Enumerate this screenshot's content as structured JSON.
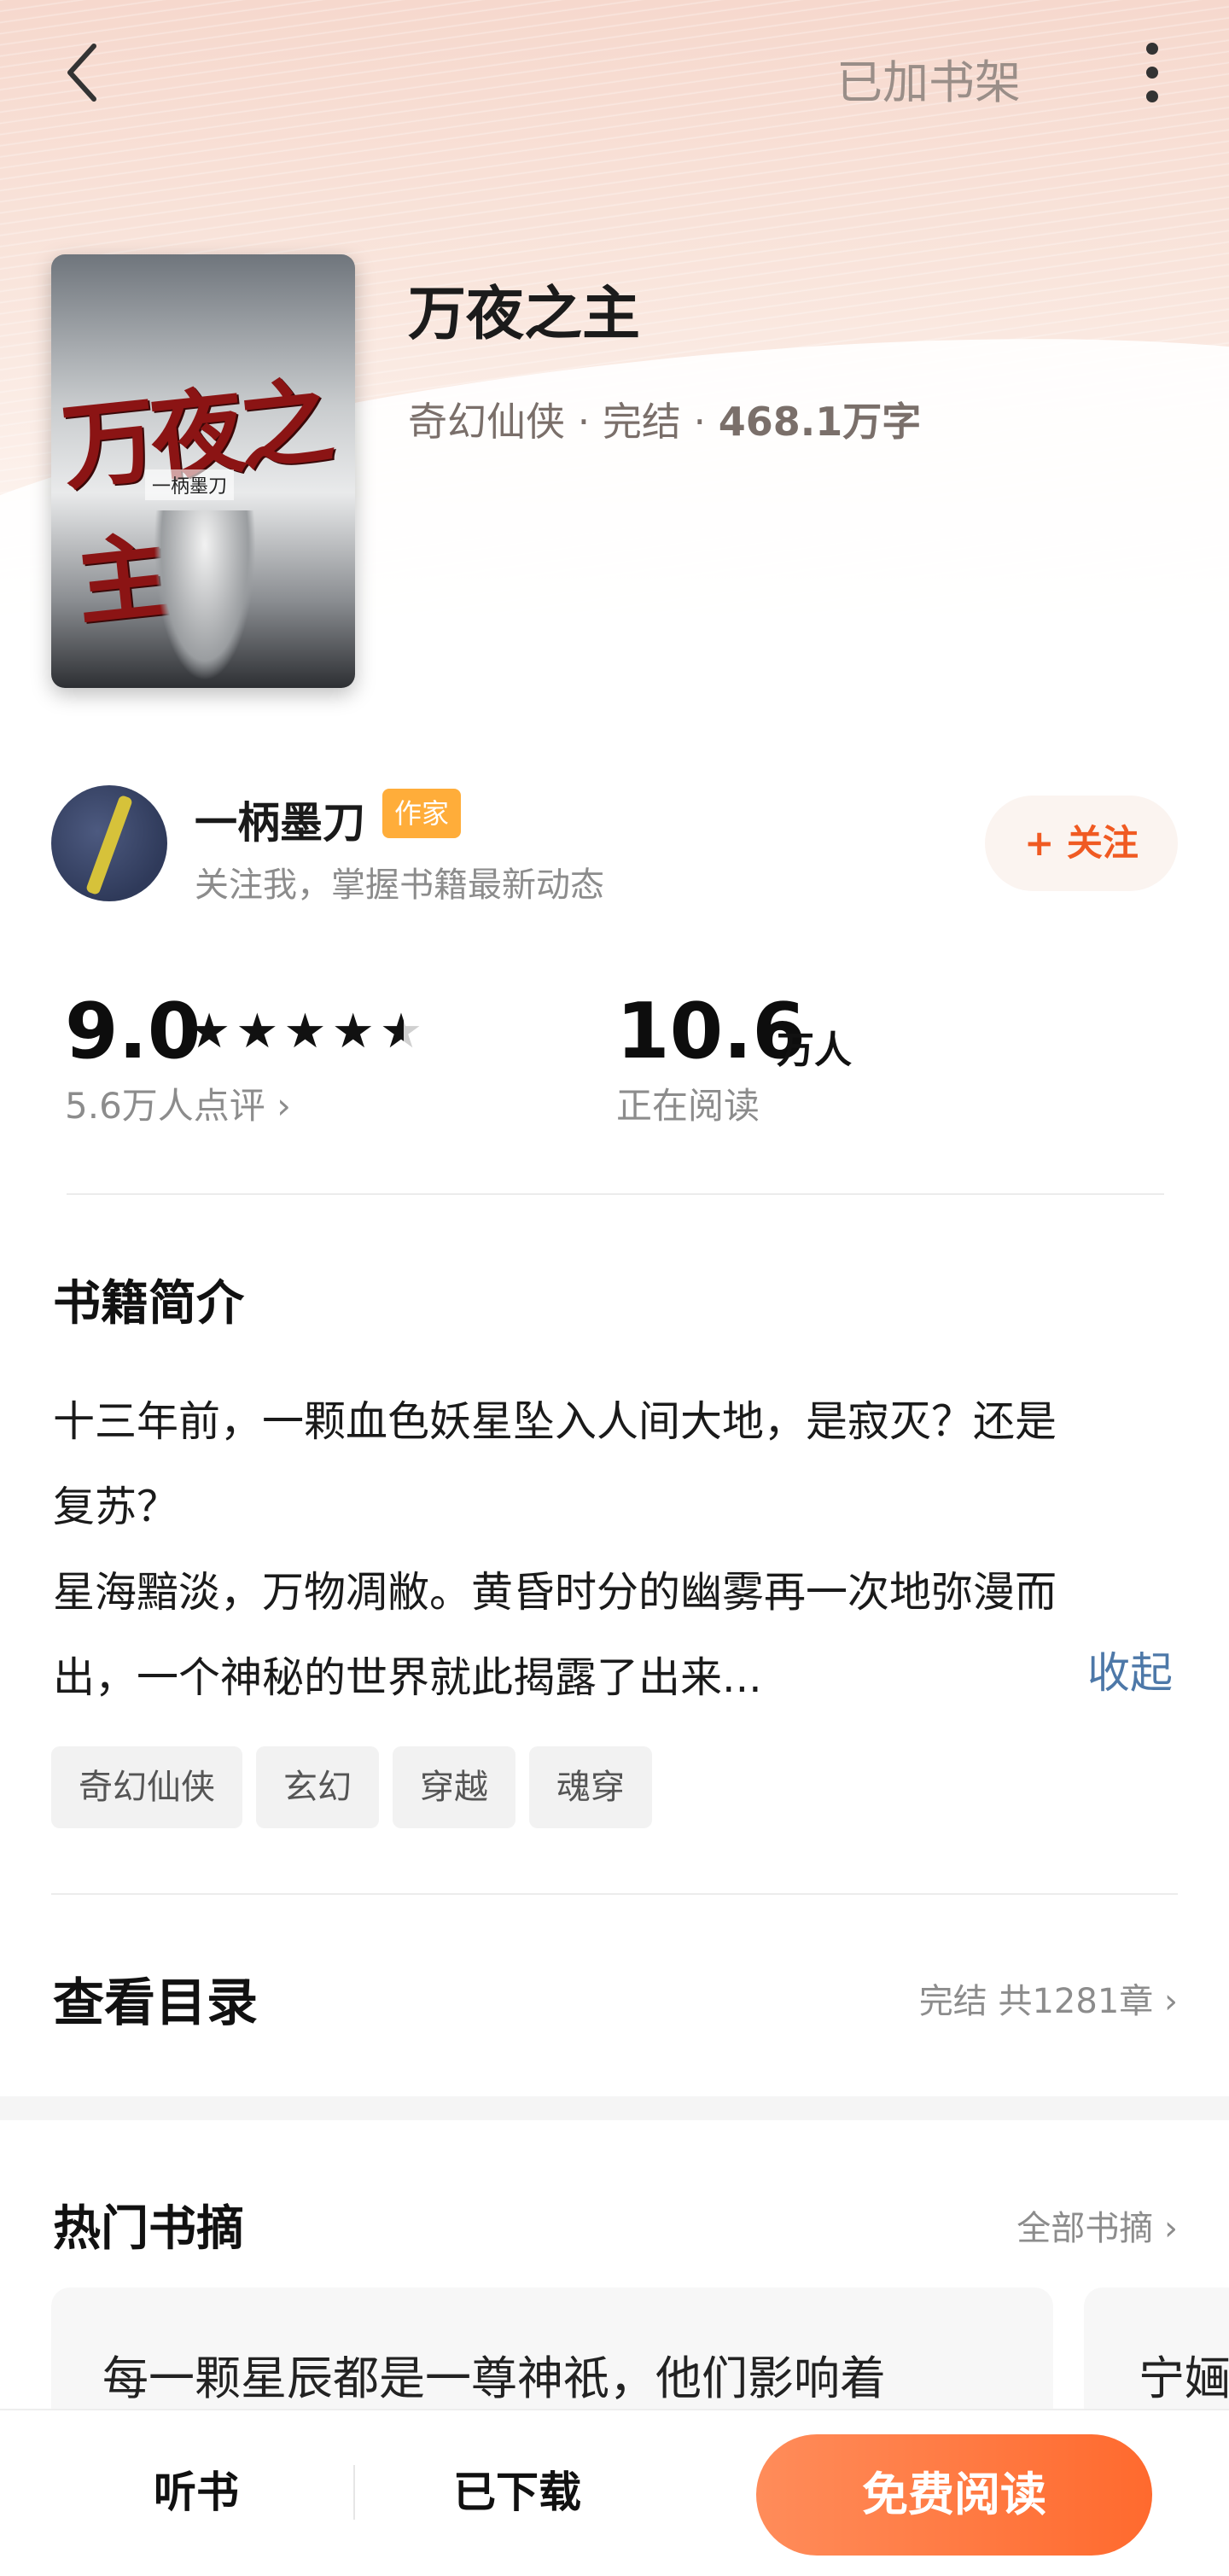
{
  "header": {
    "shelf_status": "已加书架",
    "back_icon": "back-arrow-icon",
    "more_icon": "more-vertical-icon"
  },
  "book": {
    "cover_title": "万夜之主",
    "cover_author": "一柄墨刀",
    "title": "万夜之主",
    "genre": "奇幻仙侠",
    "status": "完结",
    "word_count": "468.1万字",
    "meta_sep": " · "
  },
  "author": {
    "name": "一柄墨刀",
    "tag": "作家",
    "desc": "关注我，掌握书籍最新动态",
    "follow_label": "+ 关注"
  },
  "stats": {
    "score": "9.0",
    "stars_value": 4.5,
    "stars_max": 5,
    "review_count": "5.6万人点评",
    "readers": "10.6",
    "readers_unit": "万人",
    "readers_label": "正在阅读"
  },
  "intro": {
    "title": "书籍简介",
    "lines": [
      "十三年前，一颗血色妖星坠入人间大地，是寂灭？还是",
      "复苏？",
      "星海黯淡，万物凋敝。黄昏时分的幽雾再一次地弥漫而",
      "出，一个神秘的世界就此揭露了出来..."
    ],
    "collapse_label": "收起",
    "tags": [
      "奇幻仙侠",
      "玄幻",
      "穿越",
      "魂穿"
    ]
  },
  "toc": {
    "title": "查看目录",
    "meta": "完结 共1281章"
  },
  "excerpts": {
    "title": "热门书摘",
    "link": "全部书摘",
    "cards": [
      "每一颗星辰都是一尊神祇，他们影响着",
      "宁婳"
    ]
  },
  "bottom": {
    "listen": "听书",
    "downloaded": "已下载",
    "read": "免费阅读"
  },
  "colors": {
    "accent": "#ff6a2e",
    "follow_text": "#f05a22",
    "tag_author": "#ffad3a",
    "link_blue": "#4d78a8"
  }
}
